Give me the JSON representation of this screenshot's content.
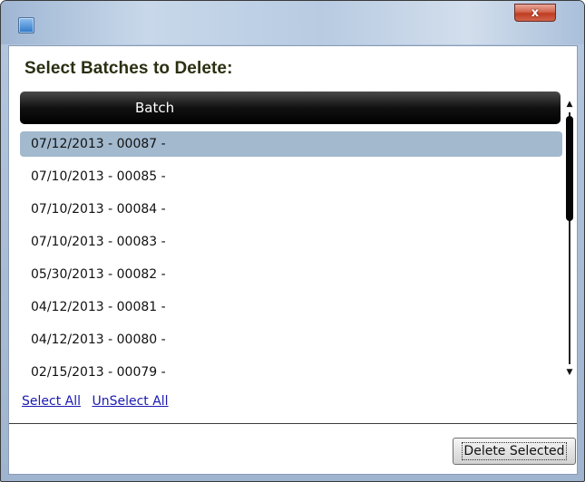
{
  "window": {
    "title_icon": "app-icon",
    "close_label": "x"
  },
  "dialog": {
    "heading": "Select Batches to Delete:",
    "column_header": "Batch"
  },
  "batches": [
    {
      "label": "07/12/2013 - 00087 -",
      "selected": true
    },
    {
      "label": "07/10/2013 - 00085 -",
      "selected": false
    },
    {
      "label": "07/10/2013 - 00084 -",
      "selected": false
    },
    {
      "label": "07/10/2013 - 00083 -",
      "selected": false
    },
    {
      "label": "05/30/2013 - 00082 -",
      "selected": false
    },
    {
      "label": "04/12/2013 - 00081 -",
      "selected": false
    },
    {
      "label": "04/12/2013 - 00080 -",
      "selected": false
    },
    {
      "label": "02/15/2013 - 00079 -",
      "selected": false
    }
  ],
  "scrollbar": {
    "up_icon": "▲",
    "down_icon": "▼"
  },
  "links": {
    "select_all": "Select All",
    "unselect_all": "UnSelect All"
  },
  "buttons": {
    "delete_selected": "Delete Selected"
  }
}
